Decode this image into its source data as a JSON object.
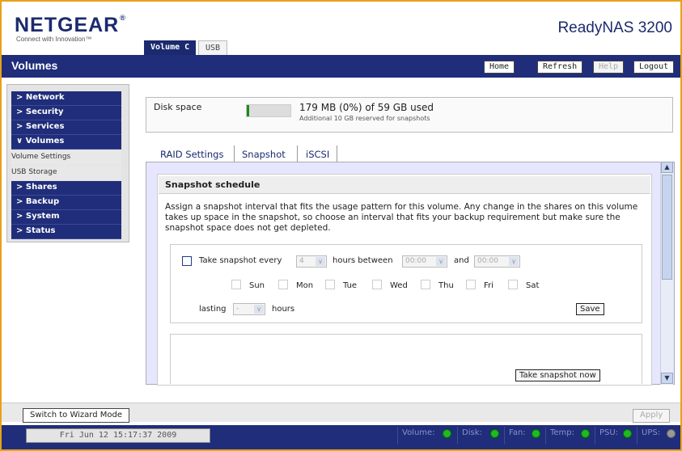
{
  "header": {
    "logo": "NETGEAR",
    "logo_mark": "®",
    "tagline": "Connect with Innovation™",
    "product": "ReadyNAS 3200",
    "volume_tabs": [
      "Volume C",
      "USB"
    ]
  },
  "titlebar": {
    "title": "Volumes",
    "buttons": {
      "home": "Home",
      "refresh": "Refresh",
      "help": "Help",
      "logout": "Logout"
    }
  },
  "nav": {
    "items": [
      {
        "label": "Network",
        "expanded": false
      },
      {
        "label": "Security",
        "expanded": false
      },
      {
        "label": "Services",
        "expanded": false
      },
      {
        "label": "Volumes",
        "expanded": true
      },
      {
        "label": "Shares",
        "expanded": false
      },
      {
        "label": "Backup",
        "expanded": false
      },
      {
        "label": "System",
        "expanded": false
      },
      {
        "label": "Status",
        "expanded": false
      }
    ],
    "subitems": [
      "Volume Settings",
      "USB Storage"
    ]
  },
  "disk": {
    "label": "Disk space",
    "used": "179 MB (0%) of 59 GB used",
    "reserved": "Additional 10 GB reserved for snapshots",
    "fill_fraction": 0.0
  },
  "tabs": [
    "RAID Settings",
    "Snapshot",
    "iSCSI"
  ],
  "snapshot": {
    "title": "Snapshot schedule",
    "description": "Assign a snapshot interval that fits the usage pattern for this volume. Any change in the shares on this volume takes up space in the snapshot, so choose an interval that fits your backup requirement but make sure the snapshot space does not get depleted.",
    "take_every_label": "Take snapshot every",
    "interval_value": "4",
    "hours_between_label": "hours between",
    "from_time": "00:00",
    "and_label": "and",
    "to_time": "00:00",
    "days": [
      "Sun",
      "Mon",
      "Tue",
      "Wed",
      "Thu",
      "Fri",
      "Sat"
    ],
    "lasting_label": "lasting",
    "lasting_value": "-",
    "hours_label": "hours",
    "save_label": "Save",
    "take_now_label": "Take snapshot now"
  },
  "footer": {
    "wizard_label": "Switch to Wizard Mode",
    "apply_label": "Apply",
    "datetime": "Fri Jun 12  15:17:37 2009",
    "status": [
      {
        "label": "Volume:",
        "state": "ok"
      },
      {
        "label": "Disk:",
        "state": "ok"
      },
      {
        "label": "Fan:",
        "state": "ok"
      },
      {
        "label": "Temp:",
        "state": "ok"
      },
      {
        "label": "PSU:",
        "state": "ok"
      },
      {
        "label": "UPS:",
        "state": "off"
      }
    ]
  },
  "colors": {
    "brand_navy": "#1f2d7a",
    "frame_orange": "#e8a217",
    "status_green": "#1dbb1d"
  }
}
